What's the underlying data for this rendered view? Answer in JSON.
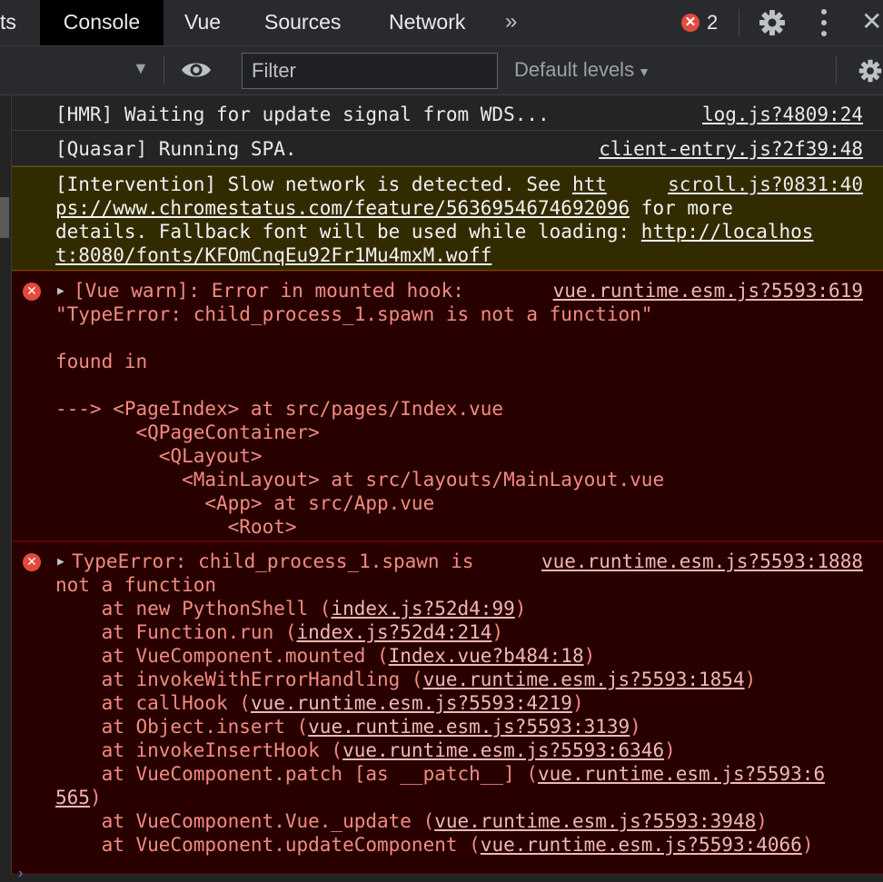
{
  "tabs": [
    "ts",
    "Console",
    "Vue",
    "Sources",
    "Network"
  ],
  "more_tabs": "»",
  "error_count": "2",
  "toolbar": {
    "filter_placeholder": "Filter",
    "levels": "Default levels"
  },
  "messages": [
    {
      "type": "log",
      "text": "[HMR] Waiting for update signal from WDS...",
      "source": "log.js?4809:24"
    },
    {
      "type": "log",
      "text": "[Quasar] Running SPA.",
      "source": "client-entry.js?2f39:48"
    },
    {
      "type": "warn",
      "lines": [
        {
          "t1": "[Intervention] Slow network is detected. See ",
          "l1": "htt"
        },
        {
          "l1": "ps://www.chromestatus.com/feature/5636954674692096",
          "t2": " for more"
        },
        {
          "t1": "details. Fallback font will be used while loading: ",
          "l1": "http://localhos"
        },
        {
          "l1": "t:8080/fonts/KFOmCnqEu92Fr1Mu4mxM.woff"
        }
      ],
      "source": "scroll.js?0831:40"
    },
    {
      "type": "error",
      "source": "vue.runtime.esm.js?5593:619",
      "lines": [
        "[Vue warn]: Error in mounted hook:",
        "\"TypeError: child_process_1.spawn is not a function\"",
        "",
        "found in",
        "",
        "---> <PageIndex> at src/pages/Index.vue",
        "       <QPageContainer>",
        "         <QLayout>",
        "           <MainLayout> at src/layouts/MainLayout.vue",
        "             <App> at src/App.vue",
        "               <Root>"
      ]
    },
    {
      "type": "error",
      "source": "vue.runtime.esm.js?5593:1888",
      "lines": [
        {
          "t1": "TypeError: child_process_1.spawn is"
        },
        {
          "t1": "not a function"
        },
        {
          "t1": "    at new PythonShell (",
          "l1": "index.js?52d4:99",
          "t2": ")"
        },
        {
          "t1": "    at Function.run (",
          "l1": "index.js?52d4:214",
          "t2": ")"
        },
        {
          "t1": "    at VueComponent.mounted (",
          "l1": "Index.vue?b484:18",
          "t2": ")"
        },
        {
          "t1": "    at invokeWithErrorHandling (",
          "l1": "vue.runtime.esm.js?5593:1854",
          "t2": ")"
        },
        {
          "t1": "    at callHook (",
          "l1": "vue.runtime.esm.js?5593:4219",
          "t2": ")"
        },
        {
          "t1": "    at Object.insert (",
          "l1": "vue.runtime.esm.js?5593:3139",
          "t2": ")"
        },
        {
          "t1": "    at invokeInsertHook (",
          "l1": "vue.runtime.esm.js?5593:6346",
          "t2": ")"
        },
        {
          "t1": "    at VueComponent.patch [as __patch__] (",
          "l1": "vue.runtime.esm.js?5593:6"
        },
        {
          "l1": "565",
          "t2": ")"
        },
        {
          "t1": "    at VueComponent.Vue._update (",
          "l1": "vue.runtime.esm.js?5593:3948",
          "t2": ")"
        },
        {
          "t1": "    at VueComponent.updateComponent (",
          "l1": "vue.runtime.esm.js?5593:4066",
          "t2": ")"
        }
      ]
    }
  ]
}
